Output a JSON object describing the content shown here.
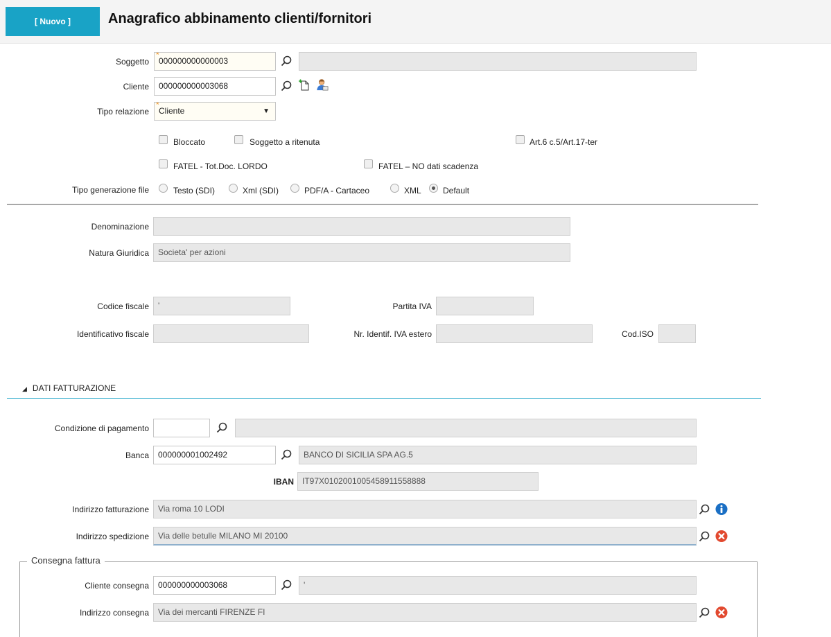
{
  "header": {
    "badge": "[ Nuovo ]",
    "title": "Anagrafico abbinamento clienti/fornitori"
  },
  "soggetto": {
    "label": "Soggetto",
    "value": "000000000000003",
    "description": ""
  },
  "cliente": {
    "label": "Cliente",
    "value": "000000000003068"
  },
  "tipo_relazione": {
    "label": "Tipo relazione",
    "value": "Cliente"
  },
  "checkboxes": {
    "bloccato": {
      "label": "Bloccato",
      "checked": false
    },
    "soggetto_ritenuta": {
      "label": "Soggetto a ritenuta",
      "checked": false
    },
    "art6": {
      "label": "Art.6 c.5/Art.17-ter",
      "checked": false
    },
    "fatel_lordo": {
      "label": "FATEL - Tot.Doc. LORDO",
      "checked": false
    },
    "fatel_no_scadenza": {
      "label": "FATEL – NO dati scadenza",
      "checked": false
    }
  },
  "tipo_generazione": {
    "label": "Tipo generazione file",
    "options": [
      {
        "label": "Testo (SDI)",
        "selected": false
      },
      {
        "label": "Xml (SDI)",
        "selected": false
      },
      {
        "label": "PDF/A - Cartaceo",
        "selected": false
      },
      {
        "label": "XML",
        "selected": false
      },
      {
        "label": "Default",
        "selected": true
      }
    ]
  },
  "denominazione": {
    "label": "Denominazione",
    "value": ""
  },
  "natura_giuridica": {
    "label": "Natura Giuridica",
    "value": "Societa' per azioni"
  },
  "codice_fiscale": {
    "label": "Codice fiscale",
    "value": "'"
  },
  "partita_iva": {
    "label": "Partita IVA",
    "value": ""
  },
  "identificativo_fiscale": {
    "label": "Identificativo fiscale",
    "value": ""
  },
  "nr_iva_estero": {
    "label": "Nr. Identif. IVA estero",
    "value": ""
  },
  "cod_iso": {
    "label": "Cod.ISO",
    "value": ""
  },
  "dati_fatturazione": {
    "title": "DATI FATTURAZIONE"
  },
  "condizione_pagamento": {
    "label": "Condizione di pagamento",
    "code": "",
    "description": ""
  },
  "banca": {
    "label": "Banca",
    "code": "000000001002492",
    "description": "BANCO DI SICILIA SPA AG.5"
  },
  "iban": {
    "label": "IBAN",
    "value": "IT97X0102001005458911558888"
  },
  "indirizzo_fatturazione": {
    "label": "Indirizzo fatturazione",
    "value": "Via roma 10 LODI"
  },
  "indirizzo_spedizione": {
    "label": "Indirizzo spedizione",
    "value": "Via delle betulle MILANO MI 20100"
  },
  "consegna": {
    "legend": "Consegna fattura",
    "cliente_label": "Cliente consegna",
    "cliente_value": "000000000003068",
    "cliente_description": "'",
    "indirizzo_label": "Indirizzo consegna",
    "indirizzo_value": "Via dei mercanti FIRENZE FI"
  },
  "colors": {
    "accent": "#19a3c6",
    "required": "#f08a10",
    "info": "#1a6fc4",
    "remove": "#e2492f"
  }
}
